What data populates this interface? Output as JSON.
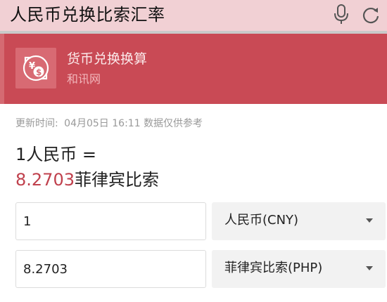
{
  "search": {
    "query": "人民币兑换比索汇率"
  },
  "banner": {
    "title": "货币兑换换算",
    "source": "和讯网",
    "accent_color": "#c94a55"
  },
  "converter": {
    "update_label": "更新时间:",
    "update_time": "04月05日 16:11",
    "disclaimer": "数据仅供参考",
    "base_amount_text": "1人民币 =",
    "rate_value": "8.2703",
    "target_currency_name": "菲律宾比索",
    "rows": [
      {
        "amount": "1",
        "currency": "人民币(CNY)"
      },
      {
        "amount": "8.2703",
        "currency": "菲律宾比索(PHP)"
      }
    ]
  }
}
